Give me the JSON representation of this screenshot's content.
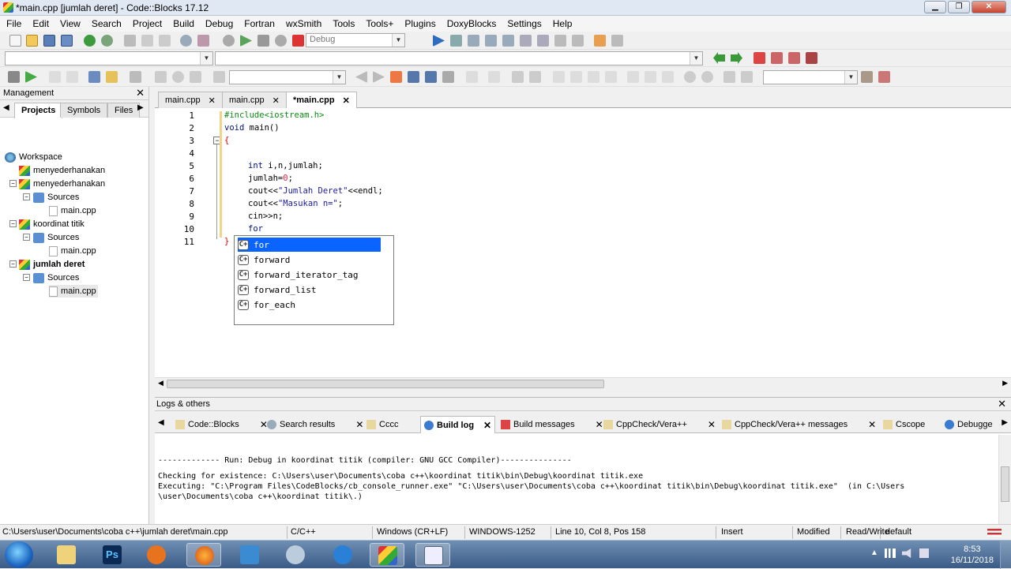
{
  "window": {
    "title": "*main.cpp [jumlah deret] - Code::Blocks 17.12"
  },
  "menu": [
    "File",
    "Edit",
    "View",
    "Search",
    "Project",
    "Build",
    "Debug",
    "Fortran",
    "wxSmith",
    "Tools",
    "Tools+",
    "Plugins",
    "DoxyBlocks",
    "Settings",
    "Help"
  ],
  "toolbar": {
    "build_target": "Debug"
  },
  "management": {
    "title": "Management",
    "tabs": [
      "Projects",
      "Symbols",
      "Files"
    ],
    "tree": {
      "workspace": "Workspace",
      "p1": "menyederhanakan",
      "p2": "menyederhanakan",
      "p2_sources": "Sources",
      "p2_file": "main.cpp",
      "p3": "koordinat titik",
      "p3_sources": "Sources",
      "p3_file": "main.cpp",
      "p4": "jumlah deret",
      "p4_sources": "Sources",
      "p4_file": "main.cpp"
    }
  },
  "editor": {
    "tabs": [
      "main.cpp",
      "main.cpp",
      "*main.cpp"
    ],
    "line_numbers": [
      "1",
      "2",
      "3",
      "4",
      "5",
      "6",
      "7",
      "8",
      "9",
      "10",
      "11"
    ],
    "lines": {
      "l1": "#include<iostream.h>",
      "l2a": "void",
      "l2b": " main()",
      "l3": "{",
      "l5a": "int",
      "l5b": " i,n,jumlah;",
      "l6a": "jumlah=",
      "l6b": "0",
      "l6c": ";",
      "l7a": "cout<<",
      "l7b": "\"Jumlah Deret\"",
      "l7c": "<<endl;",
      "l8a": "cout<<",
      "l8b": "\"Masukan n=\"",
      "l8c": ";",
      "l9": "cin>>n;",
      "l10": "for",
      "l11": "}"
    },
    "autocomplete": [
      "for",
      "forward",
      "forward_iterator_tag",
      "forward_list",
      "for_each"
    ],
    "autocomplete_icon": "C+"
  },
  "logs": {
    "title": "Logs & others",
    "tabs": [
      "Code::Blocks",
      "Search results",
      "Cccc",
      "Build log",
      "Build messages",
      "CppCheck/Vera++",
      "CppCheck/Vera++ messages",
      "Cscope",
      "Debugge"
    ],
    "lines": [
      "------------- Run: Debug in koordinat titik (compiler: GNU GCC Compiler)---------------",
      "Checking for existence: C:\\Users\\user\\Documents\\coba c++\\koordinat titik\\bin\\Debug\\koordinat titik.exe",
      "Executing: \"C:\\Program Files\\CodeBlocks/cb_console_runner.exe\" \"C:\\Users\\user\\Documents\\coba c++\\koordinat titik\\bin\\Debug\\koordinat titik.exe\"  (in C:\\Users",
      "\\user\\Documents\\coba c++\\koordinat titik\\.)"
    ]
  },
  "status": {
    "path": "C:\\Users\\user\\Documents\\coba c++\\jumlah deret\\main.cpp",
    "language": "C/C++",
    "eol": "Windows (CR+LF)",
    "encoding": "WINDOWS-1252",
    "position": "Line 10, Col 8, Pos 158",
    "mode": "Insert",
    "modified": "Modified",
    "access": "Read/Write",
    "profile": "default"
  },
  "taskbar": {
    "time": "8:53",
    "date": "16/11/2018",
    "ps_label": "Ps"
  }
}
